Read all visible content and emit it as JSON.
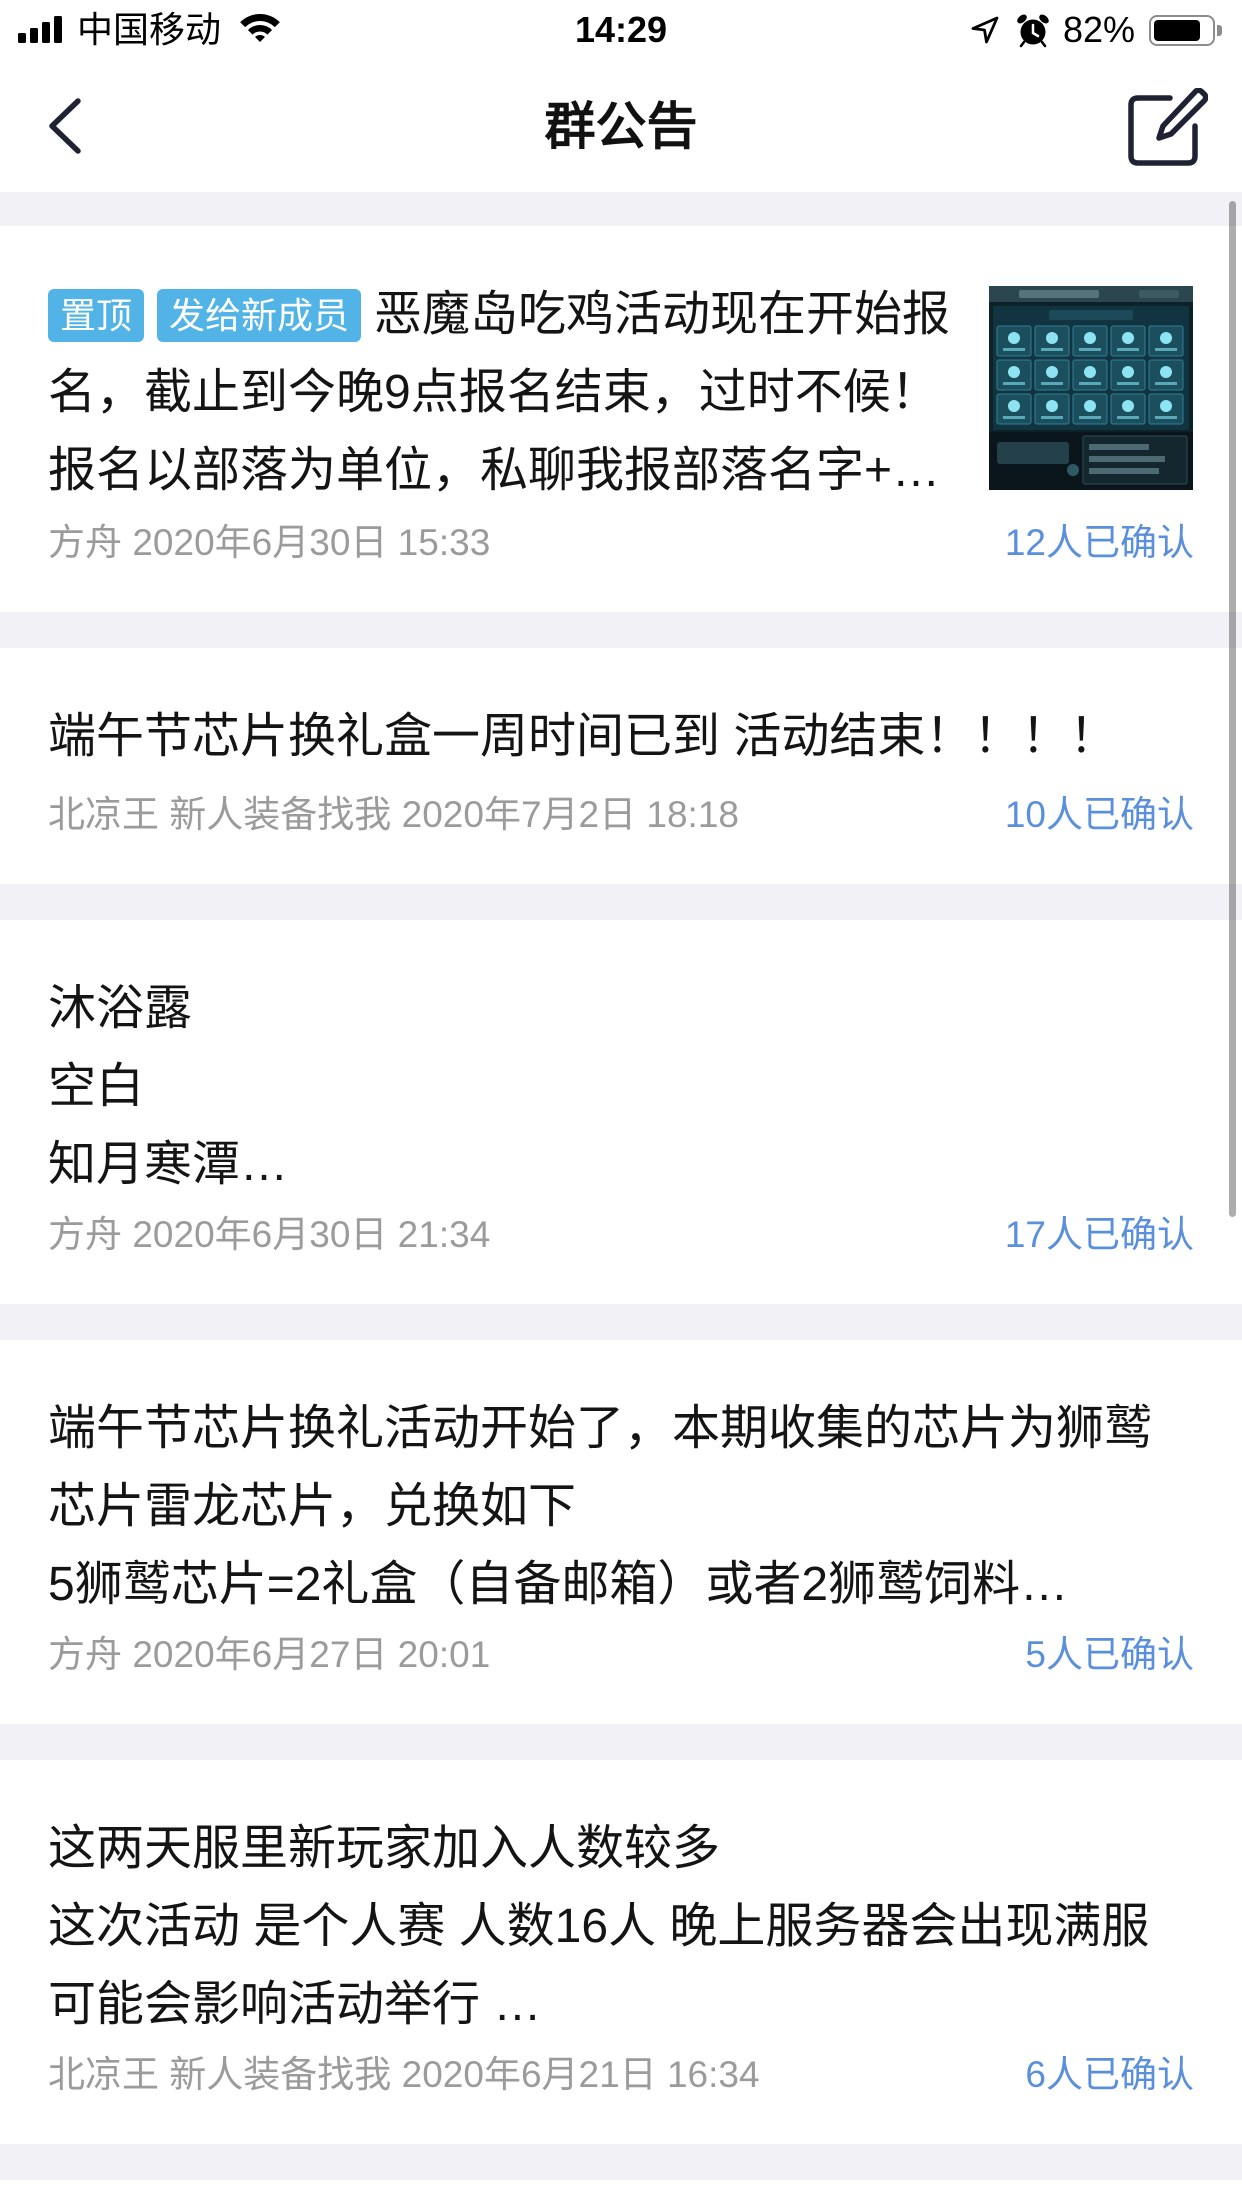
{
  "status_bar": {
    "carrier": "中国移动",
    "time": "14:29",
    "battery_text": "82%",
    "battery_level": 0.82,
    "icons": {
      "signal": "cellular-signal-icon",
      "wifi": "wifi-icon",
      "location": "location-arrow-icon",
      "alarm": "alarm-clock-icon",
      "battery": "battery-icon"
    }
  },
  "nav": {
    "title": "群公告",
    "back_icon": "chevron-left-icon",
    "action_icon": "compose-icon"
  },
  "announcements": [
    {
      "tags": [
        "置顶",
        "发给新成员"
      ],
      "lines": [
        "恶魔岛吃鸡活动现在开始报",
        "名，截止到今晚9点报名结束，过时不候！",
        "报名以部落为单位，私聊我报部落名字+…"
      ],
      "author": "方舟",
      "time": "2020年6月30日 15:33",
      "confirmed": "12人已确认"
    },
    {
      "lines": [
        "端午节芯片换礼盒一周时间已到 活动结束！！！！"
      ],
      "author": "北凉王 新人装备找我",
      "time": "2020年7月2日 18:18",
      "confirmed": "10人已确认"
    },
    {
      "lines": [
        "沐浴露",
        "空白",
        "知月寒潭…"
      ],
      "author": "方舟",
      "time": "2020年6月30日 21:34",
      "confirmed": "17人已确认"
    },
    {
      "lines": [
        "端午节芯片换礼活动开始了，本期收集的芯片为狮鹫",
        "芯片雷龙芯片，兑换如下",
        "5狮鹫芯片=2礼盒（自备邮箱）或者2狮鹫饲料…"
      ],
      "author": "方舟",
      "time": "2020年6月27日 20:01",
      "confirmed": "5人已确认"
    },
    {
      "lines": [
        "这两天服里新玩家加入人数较多",
        "这次活动 是个人赛 人数16人 晚上服务器会出现满服",
        "可能会影响活动举行 …"
      ],
      "author": "北凉王 新人装备找我",
      "time": "2020年6月21日 16:34",
      "confirmed": "6人已确认"
    }
  ],
  "colors": {
    "page_background": "#F2F2F6",
    "tag_background": "#52B3E6",
    "meta_text": "#9B9B9B",
    "confirmed_text": "#5A8FDB",
    "icon": "#1E2233",
    "text": "#141414"
  }
}
